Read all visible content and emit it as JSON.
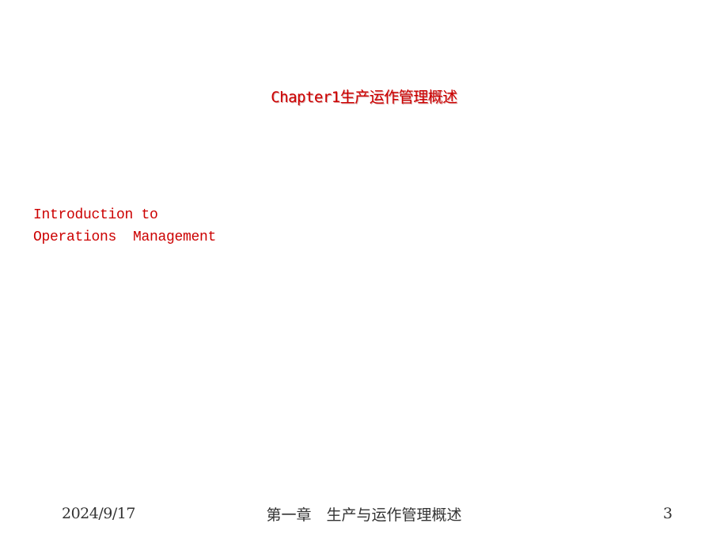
{
  "slide": {
    "title": "Chapter1生产运作管理概述",
    "subtitle_lines": [
      "Introduction to",
      "Operations  Management"
    ],
    "text_color": "#cc0000"
  },
  "footer": {
    "date": "2024/9/17",
    "center_text": "第一章　生产与运作管理概述",
    "page_number": "3"
  }
}
